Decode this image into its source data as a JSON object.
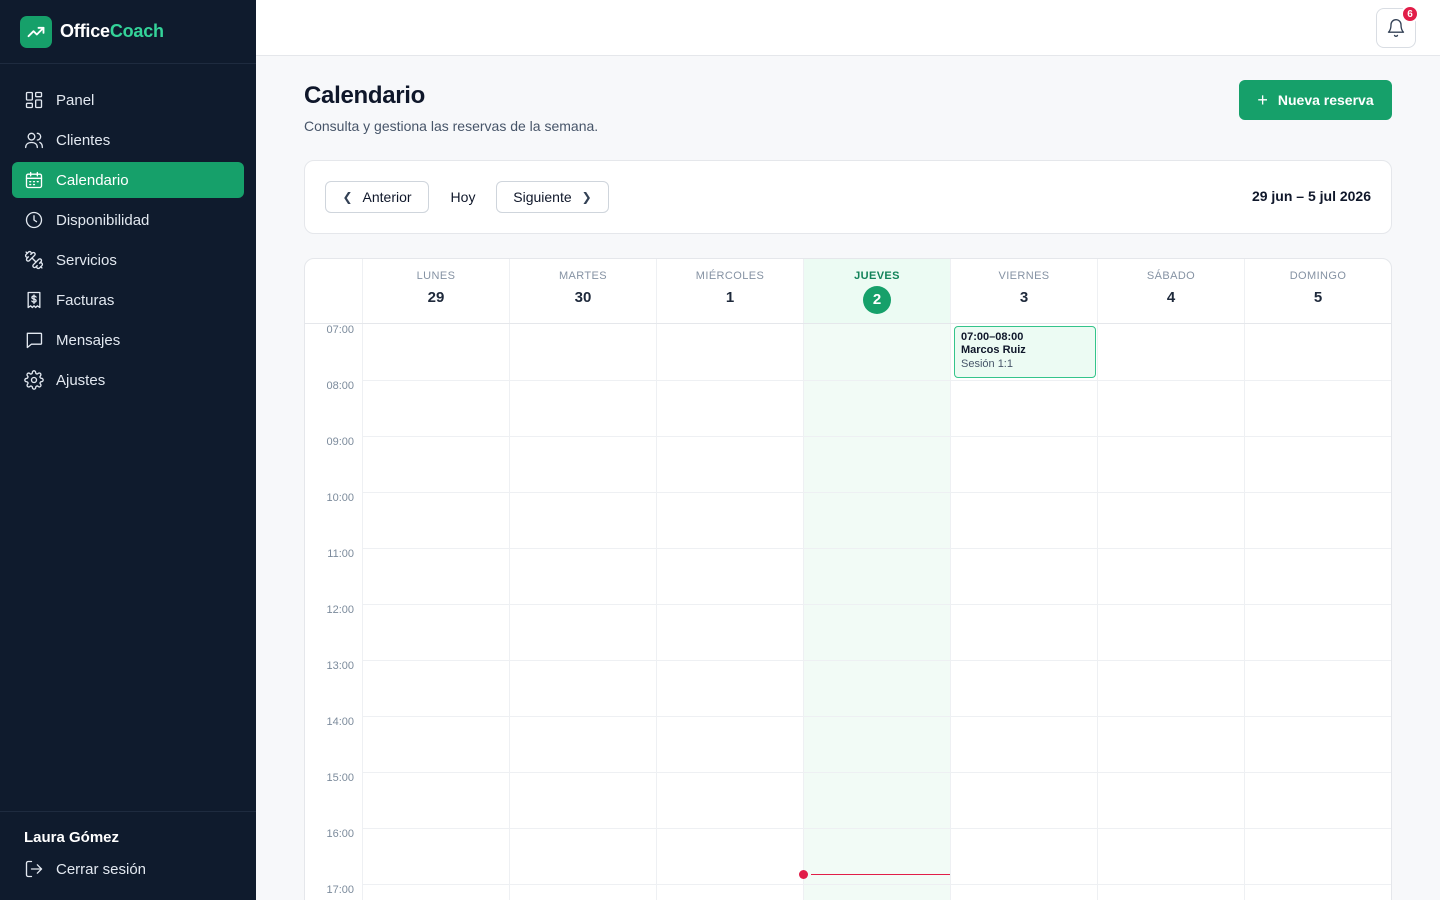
{
  "brand": {
    "name_part1": "Office",
    "name_part2": "Coach",
    "logo_icon": "trend-up-icon",
    "brand_color": "#16a06a"
  },
  "sidebar": {
    "items": [
      {
        "label": "Panel",
        "icon": "grid-icon",
        "active": false
      },
      {
        "label": "Clientes",
        "icon": "users-icon",
        "active": false
      },
      {
        "label": "Calendario",
        "icon": "calendar-icon",
        "active": true
      },
      {
        "label": "Disponibilidad",
        "icon": "clock-icon",
        "active": false
      },
      {
        "label": "Servicios",
        "icon": "dumbbell-icon",
        "active": false
      },
      {
        "label": "Facturas",
        "icon": "invoice-icon",
        "active": false
      },
      {
        "label": "Mensajes",
        "icon": "message-icon",
        "active": false
      },
      {
        "label": "Ajustes",
        "icon": "gear-icon",
        "active": false
      }
    ],
    "user_name": "Laura Gómez",
    "logout_label": "Cerrar sesión"
  },
  "topbar": {
    "notification_count": "6"
  },
  "header": {
    "title": "Calendario",
    "subtitle": "Consulta y gestiona las reservas de la semana.",
    "new_button_label": "Nueva reserva"
  },
  "toolbar": {
    "prev_label": "Anterior",
    "today_label": "Hoy",
    "next_label": "Siguiente",
    "range_label": "29 jun – 5 jul 2026"
  },
  "calendar": {
    "days": [
      {
        "name": "LUNES",
        "number": "29",
        "today": false
      },
      {
        "name": "MARTES",
        "number": "30",
        "today": false
      },
      {
        "name": "MIÉRCOLES",
        "number": "1",
        "today": false
      },
      {
        "name": "JUEVES",
        "number": "2",
        "today": true
      },
      {
        "name": "VIERNES",
        "number": "3",
        "today": false
      },
      {
        "name": "SÁBADO",
        "number": "4",
        "today": false
      },
      {
        "name": "DOMINGO",
        "number": "5",
        "today": false
      }
    ],
    "hours": [
      "07:00",
      "08:00",
      "09:00",
      "10:00",
      "11:00",
      "12:00",
      "13:00",
      "14:00",
      "15:00",
      "16:00",
      "17:00"
    ],
    "events": [
      {
        "day_index": 4,
        "time": "07:00–08:00",
        "client": "Marcos Ruiz",
        "type": "Sesión 1:1"
      }
    ],
    "accent_color": "#16a06a",
    "now_color": "#e11d48"
  }
}
